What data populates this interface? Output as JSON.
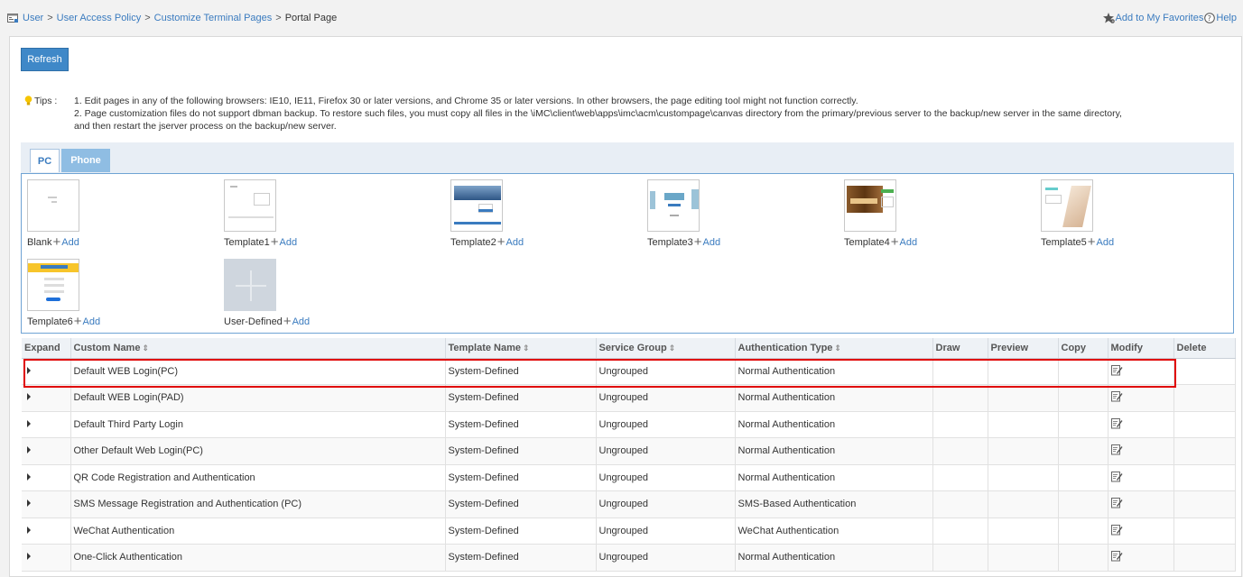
{
  "breadcrumb": {
    "items": [
      "User",
      "User Access Policy",
      "Customize Terminal Pages"
    ],
    "current": "Portal Page",
    "separator": ">"
  },
  "header_links": {
    "favorites": "Add to My Favorites",
    "help": "Help"
  },
  "toolbar": {
    "refresh_label": "Refresh"
  },
  "tips": {
    "label": "Tips :",
    "lines": [
      "1. Edit pages in any of the following browsers: IE10, IE11, Firefox 30 or later versions, and Chrome 35 or later versions. In other browsers, the page editing tool might not function correctly.",
      "2. Page customization files do not support dbman backup. To restore such files, you must copy all files in the \\iMC\\client\\web\\apps\\imc\\acm\\custompage\\canvas directory from the primary/previous server to the backup/new server in the same directory,",
      "and then restart the jserver process on the backup/new server."
    ]
  },
  "tabs": [
    {
      "label": "PC",
      "active": true
    },
    {
      "label": "Phone",
      "active": false
    }
  ],
  "templates": [
    {
      "name": "Blank",
      "add": "Add"
    },
    {
      "name": "Template1",
      "add": "Add"
    },
    {
      "name": "Template2",
      "add": "Add"
    },
    {
      "name": "Template3",
      "add": "Add"
    },
    {
      "name": "Template4",
      "add": "Add"
    },
    {
      "name": "Template5",
      "add": "Add"
    },
    {
      "name": "Template6",
      "add": "Add"
    },
    {
      "name": "User-Defined",
      "add": "Add"
    }
  ],
  "table": {
    "columns": [
      "Expand",
      "Custom Name",
      "Template Name",
      "Service Group",
      "Authentication Type",
      "Draw",
      "Preview",
      "Copy",
      "Modify",
      "Delete"
    ],
    "sort_icon": "⇕",
    "rows": [
      {
        "name": "Default WEB Login(PC)",
        "template": "System-Defined",
        "group": "Ungrouped",
        "auth": "Normal Authentication"
      },
      {
        "name": "Default WEB Login(PAD)",
        "template": "System-Defined",
        "group": "Ungrouped",
        "auth": "Normal Authentication"
      },
      {
        "name": "Default Third Party Login",
        "template": "System-Defined",
        "group": "Ungrouped",
        "auth": "Normal Authentication"
      },
      {
        "name": "Other Default Web Login(PC)",
        "template": "System-Defined",
        "group": "Ungrouped",
        "auth": "Normal Authentication"
      },
      {
        "name": "QR Code Registration and Authentication",
        "template": "System-Defined",
        "group": "Ungrouped",
        "auth": "Normal Authentication"
      },
      {
        "name": "SMS Message Registration and Authentication (PC)",
        "template": "System-Defined",
        "group": "Ungrouped",
        "auth": "SMS-Based Authentication"
      },
      {
        "name": "WeChat Authentication",
        "template": "System-Defined",
        "group": "Ungrouped",
        "auth": "WeChat Authentication"
      },
      {
        "name": "One-Click Authentication",
        "template": "System-Defined",
        "group": "Ungrouped",
        "auth": "Normal Authentication"
      }
    ]
  },
  "colors": {
    "accent": "#3a7bbf",
    "button": "#3f88c8",
    "highlight": "#e00000"
  },
  "icons": [
    "home-icon",
    "favorites-star-icon",
    "help-icon",
    "tip-bulb-icon",
    "add-plus-icon",
    "expand-arrow-icon",
    "modify-edit-icon"
  ]
}
